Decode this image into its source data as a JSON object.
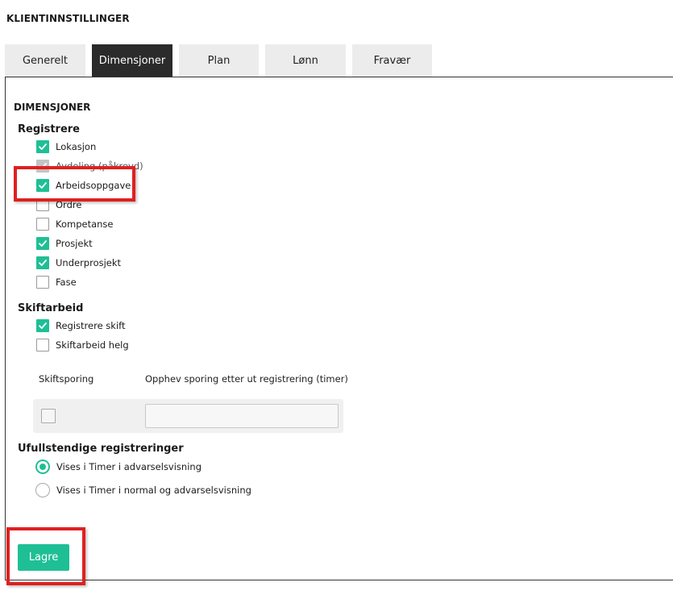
{
  "page_title": "KLIENTINNSTILLINGER",
  "tabs": [
    {
      "label": "Generelt",
      "active": false
    },
    {
      "label": "Dimensjoner",
      "active": true
    },
    {
      "label": "Plan",
      "active": false
    },
    {
      "label": "Lønn",
      "active": false
    },
    {
      "label": "Fravær",
      "active": false
    }
  ],
  "section_title": "DIMENSJONER",
  "registrere": {
    "title": "Registrere",
    "items": [
      {
        "label": "Lokasjon",
        "checked": true,
        "disabled": false
      },
      {
        "label": "Avdeling (påkrevd)",
        "checked": true,
        "disabled": true
      },
      {
        "label": "Arbeidsoppgave",
        "checked": true,
        "disabled": false
      },
      {
        "label": "Ordre",
        "checked": false,
        "disabled": false
      },
      {
        "label": "Kompetanse",
        "checked": false,
        "disabled": false
      },
      {
        "label": "Prosjekt",
        "checked": true,
        "disabled": false
      },
      {
        "label": "Underprosjekt",
        "checked": true,
        "disabled": false
      },
      {
        "label": "Fase",
        "checked": false,
        "disabled": false
      }
    ]
  },
  "skiftarbeid": {
    "title": "Skiftarbeid",
    "items": [
      {
        "label": "Registrere skift",
        "checked": true
      },
      {
        "label": "Skiftarbeid helg",
        "checked": false
      }
    ],
    "col_skiftsporing": "Skiftsporing",
    "col_opphev": "Opphev sporing etter ut registrering (timer)",
    "skiftsporing_checked": false,
    "hours_value": ""
  },
  "ufullstendige": {
    "title": "Ufullstendige registreringer",
    "options": [
      {
        "label": "Vises i Timer i advarselsvisning",
        "selected": true
      },
      {
        "label": "Vises i Timer i normal og advarselsvisning",
        "selected": false
      }
    ]
  },
  "save_label": "Lagre",
  "colors": {
    "accent": "#1fbf95",
    "highlight": "#e02020",
    "tab_active": "#2b2b2b"
  }
}
